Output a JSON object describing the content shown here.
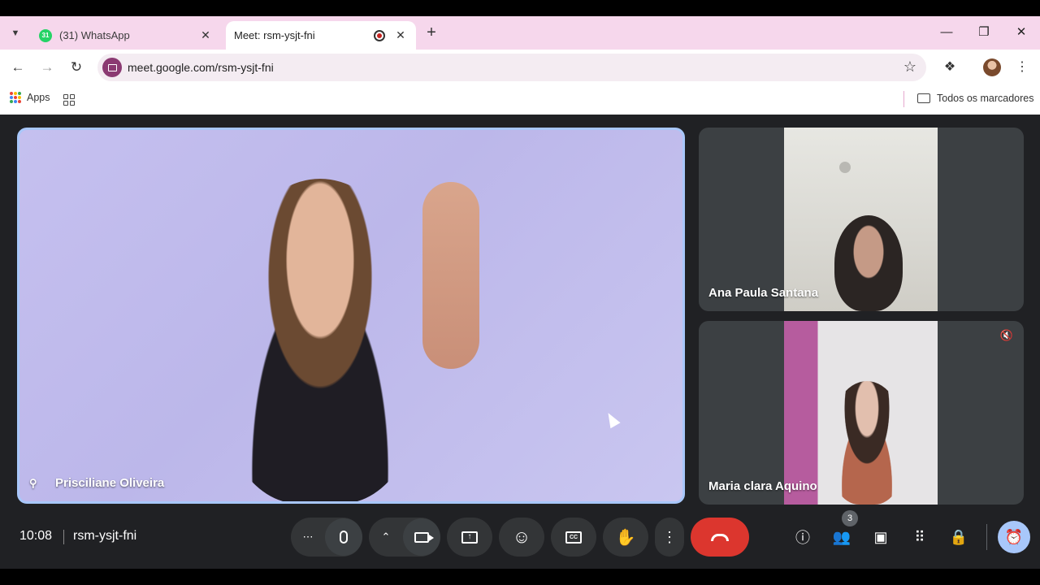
{
  "browser": {
    "tabs": [
      {
        "title": "(31) WhatsApp",
        "favicon": "whatsapp-icon",
        "badge": "31",
        "active": false
      },
      {
        "title": "Meet: rsm-ysjt-fni",
        "favicon": "google-meet-icon",
        "recording": true,
        "active": true
      }
    ],
    "url": "meet.google.com/rsm-ysjt-fni",
    "bookmarks": {
      "apps_label": "Apps",
      "all_bookmarks_label": "Todos os marcadores"
    },
    "theme_color": "#f6d7ec"
  },
  "meet": {
    "time": "10:08",
    "meeting_code": "rsm-ysjt-fni",
    "participants": [
      {
        "name": "Prisciliane Oliveira",
        "pinned": true,
        "featured": true
      },
      {
        "name": "Ana Paula Santana",
        "muted": false
      },
      {
        "name": "Maria clara Aquino",
        "muted": true
      }
    ],
    "participant_count": "3",
    "controls": {
      "more_options": "more-options-icon",
      "mic": "microphone-icon",
      "camera": "camera-icon",
      "present": "present-screen-icon",
      "reactions": "emoji-icon",
      "captions": "captions-icon",
      "raise_hand": "raise-hand-icon",
      "more": "more-vert-icon",
      "leave": "leave-call-icon"
    },
    "colors": {
      "background": "#202124",
      "leave": "#dc362e",
      "active_border": "#a8c7fa"
    }
  }
}
